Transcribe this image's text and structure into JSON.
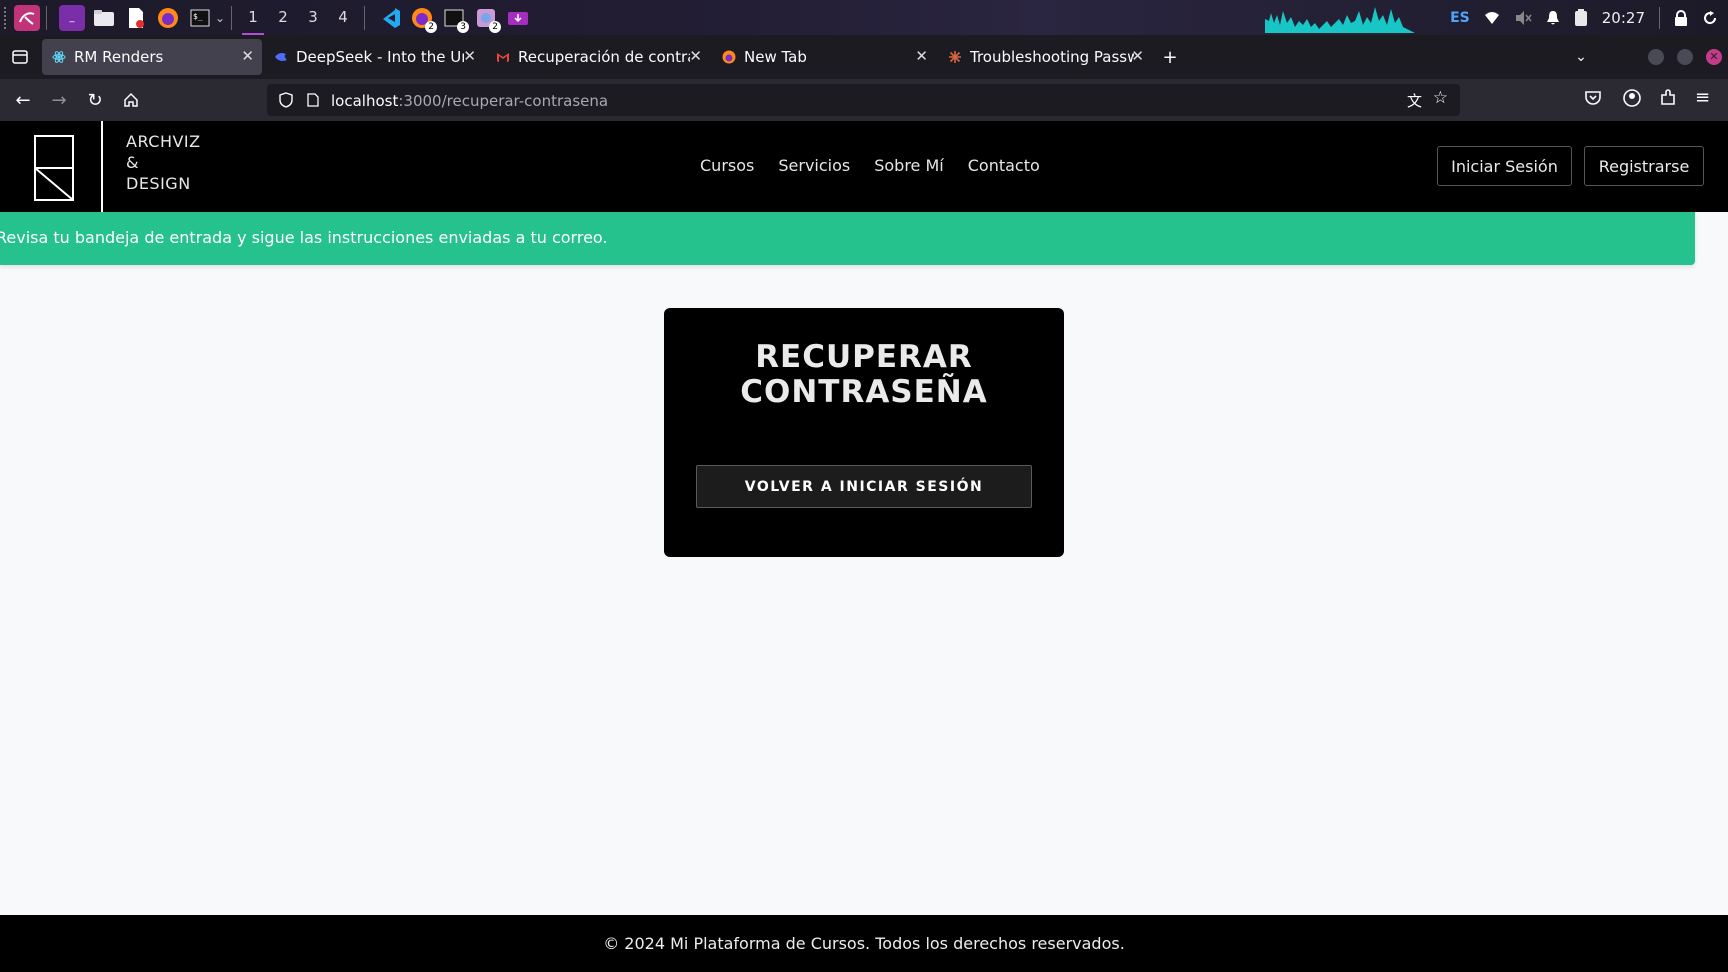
{
  "taskbar": {
    "workspaces": [
      "1",
      "2",
      "3",
      "4"
    ],
    "language": "ES",
    "time": "20:27",
    "badges": {
      "firefox": "2",
      "terminal": "3",
      "app": "2"
    }
  },
  "browser": {
    "tabs": [
      {
        "title": "RM Renders",
        "active": true
      },
      {
        "title": "DeepSeek - Into the Unkn"
      },
      {
        "title": "Recuperación de contrase"
      },
      {
        "title": "New Tab"
      },
      {
        "title": "Troubleshooting Passwor"
      }
    ],
    "url": {
      "host": "localhost",
      "path": ":3000/recuperar-contrasena"
    }
  },
  "site": {
    "brand_lines": [
      "ARCHVIZ",
      "&",
      "DESIGN"
    ],
    "nav": [
      "Cursos",
      "Servicios",
      "Sobre Mí",
      "Contacto"
    ],
    "login_label": "Iniciar Sesión",
    "register_label": "Registrarse",
    "alert": "Revisa tu bandeja de entrada y sigue las instrucciones enviadas a tu correo.",
    "card": {
      "title_line1": "RECUPERAR",
      "title_line2": "CONTRASEÑA",
      "button": "VOLVER A INICIAR SESIÓN"
    },
    "footer": "© 2024 Mi Plataforma de Cursos. Todos los derechos reservados."
  },
  "colors": {
    "alert_bg": "#26c28d",
    "header_bg": "#000000",
    "page_bg": "#f7f9fb",
    "accent_purple": "#b04fd6"
  }
}
